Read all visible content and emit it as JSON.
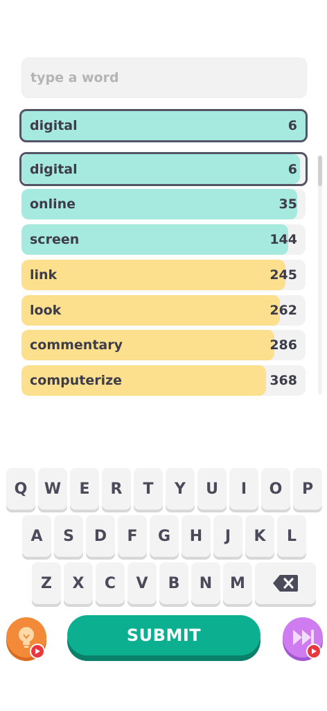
{
  "input": {
    "placeholder": "type a word",
    "value": ""
  },
  "current_guess": {
    "word": "digital",
    "rank": "6"
  },
  "guesses": [
    {
      "word": "digital",
      "rank": "6",
      "closeness": 0.98,
      "color": "#a6eadf",
      "selected": true
    },
    {
      "word": "online",
      "rank": "35",
      "closeness": 0.97,
      "color": "#a6eadf",
      "selected": false
    },
    {
      "word": "screen",
      "rank": "144",
      "closeness": 0.94,
      "color": "#a6eadf",
      "selected": false
    },
    {
      "word": "link",
      "rank": "245",
      "closeness": 0.93,
      "color": "#fde08e",
      "selected": false
    },
    {
      "word": "look",
      "rank": "262",
      "closeness": 0.91,
      "color": "#fde08e",
      "selected": false
    },
    {
      "word": "commentary",
      "rank": "286",
      "closeness": 0.89,
      "color": "#fde08e",
      "selected": false
    },
    {
      "word": "computerize",
      "rank": "368",
      "closeness": 0.86,
      "color": "#fde08e",
      "selected": false
    }
  ],
  "keyboard": {
    "row1": [
      "Q",
      "W",
      "E",
      "R",
      "T",
      "Y",
      "U",
      "I",
      "O",
      "P"
    ],
    "row2": [
      "A",
      "S",
      "D",
      "F",
      "G",
      "H",
      "J",
      "K",
      "L"
    ],
    "row3": [
      "Z",
      "X",
      "C",
      "V",
      "B",
      "N",
      "M"
    ]
  },
  "submit_label": "SUBMIT",
  "icons": {
    "hint": "lightbulb-icon",
    "skip": "fast-forward-icon",
    "ad": "play-icon",
    "backspace": "backspace-icon"
  },
  "colors": {
    "close": "#a6eadf",
    "medium": "#fde08e",
    "submit": "#0cb091",
    "hint": "#f28a3a",
    "skip": "#cf7cf0"
  }
}
